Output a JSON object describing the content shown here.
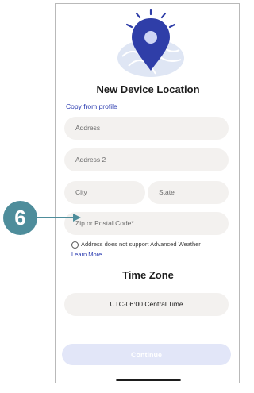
{
  "screen": {
    "title": "New Device Location",
    "copy_link": "Copy from profile",
    "hero_icon": "location-pin-icon"
  },
  "form": {
    "address_placeholder": "Address",
    "address2_placeholder": "Address 2",
    "city_placeholder": "City",
    "state_placeholder": "State",
    "zip_placeholder": "Zip or Postal Code*"
  },
  "notice": {
    "icon": "info-icon",
    "text": "Address does not support Advanced Weather",
    "link": "Learn More"
  },
  "timezone": {
    "section_title": "Time Zone",
    "selected": "UTC-06:00 Central Time"
  },
  "footer": {
    "continue_label": "Continue"
  },
  "annotation": {
    "step_number": "6"
  },
  "colors": {
    "accent": "#2a3bb0",
    "field_bg": "#f3f1ef",
    "continue_disabled": "#e2e6f8",
    "badge": "#4e8d9b"
  }
}
